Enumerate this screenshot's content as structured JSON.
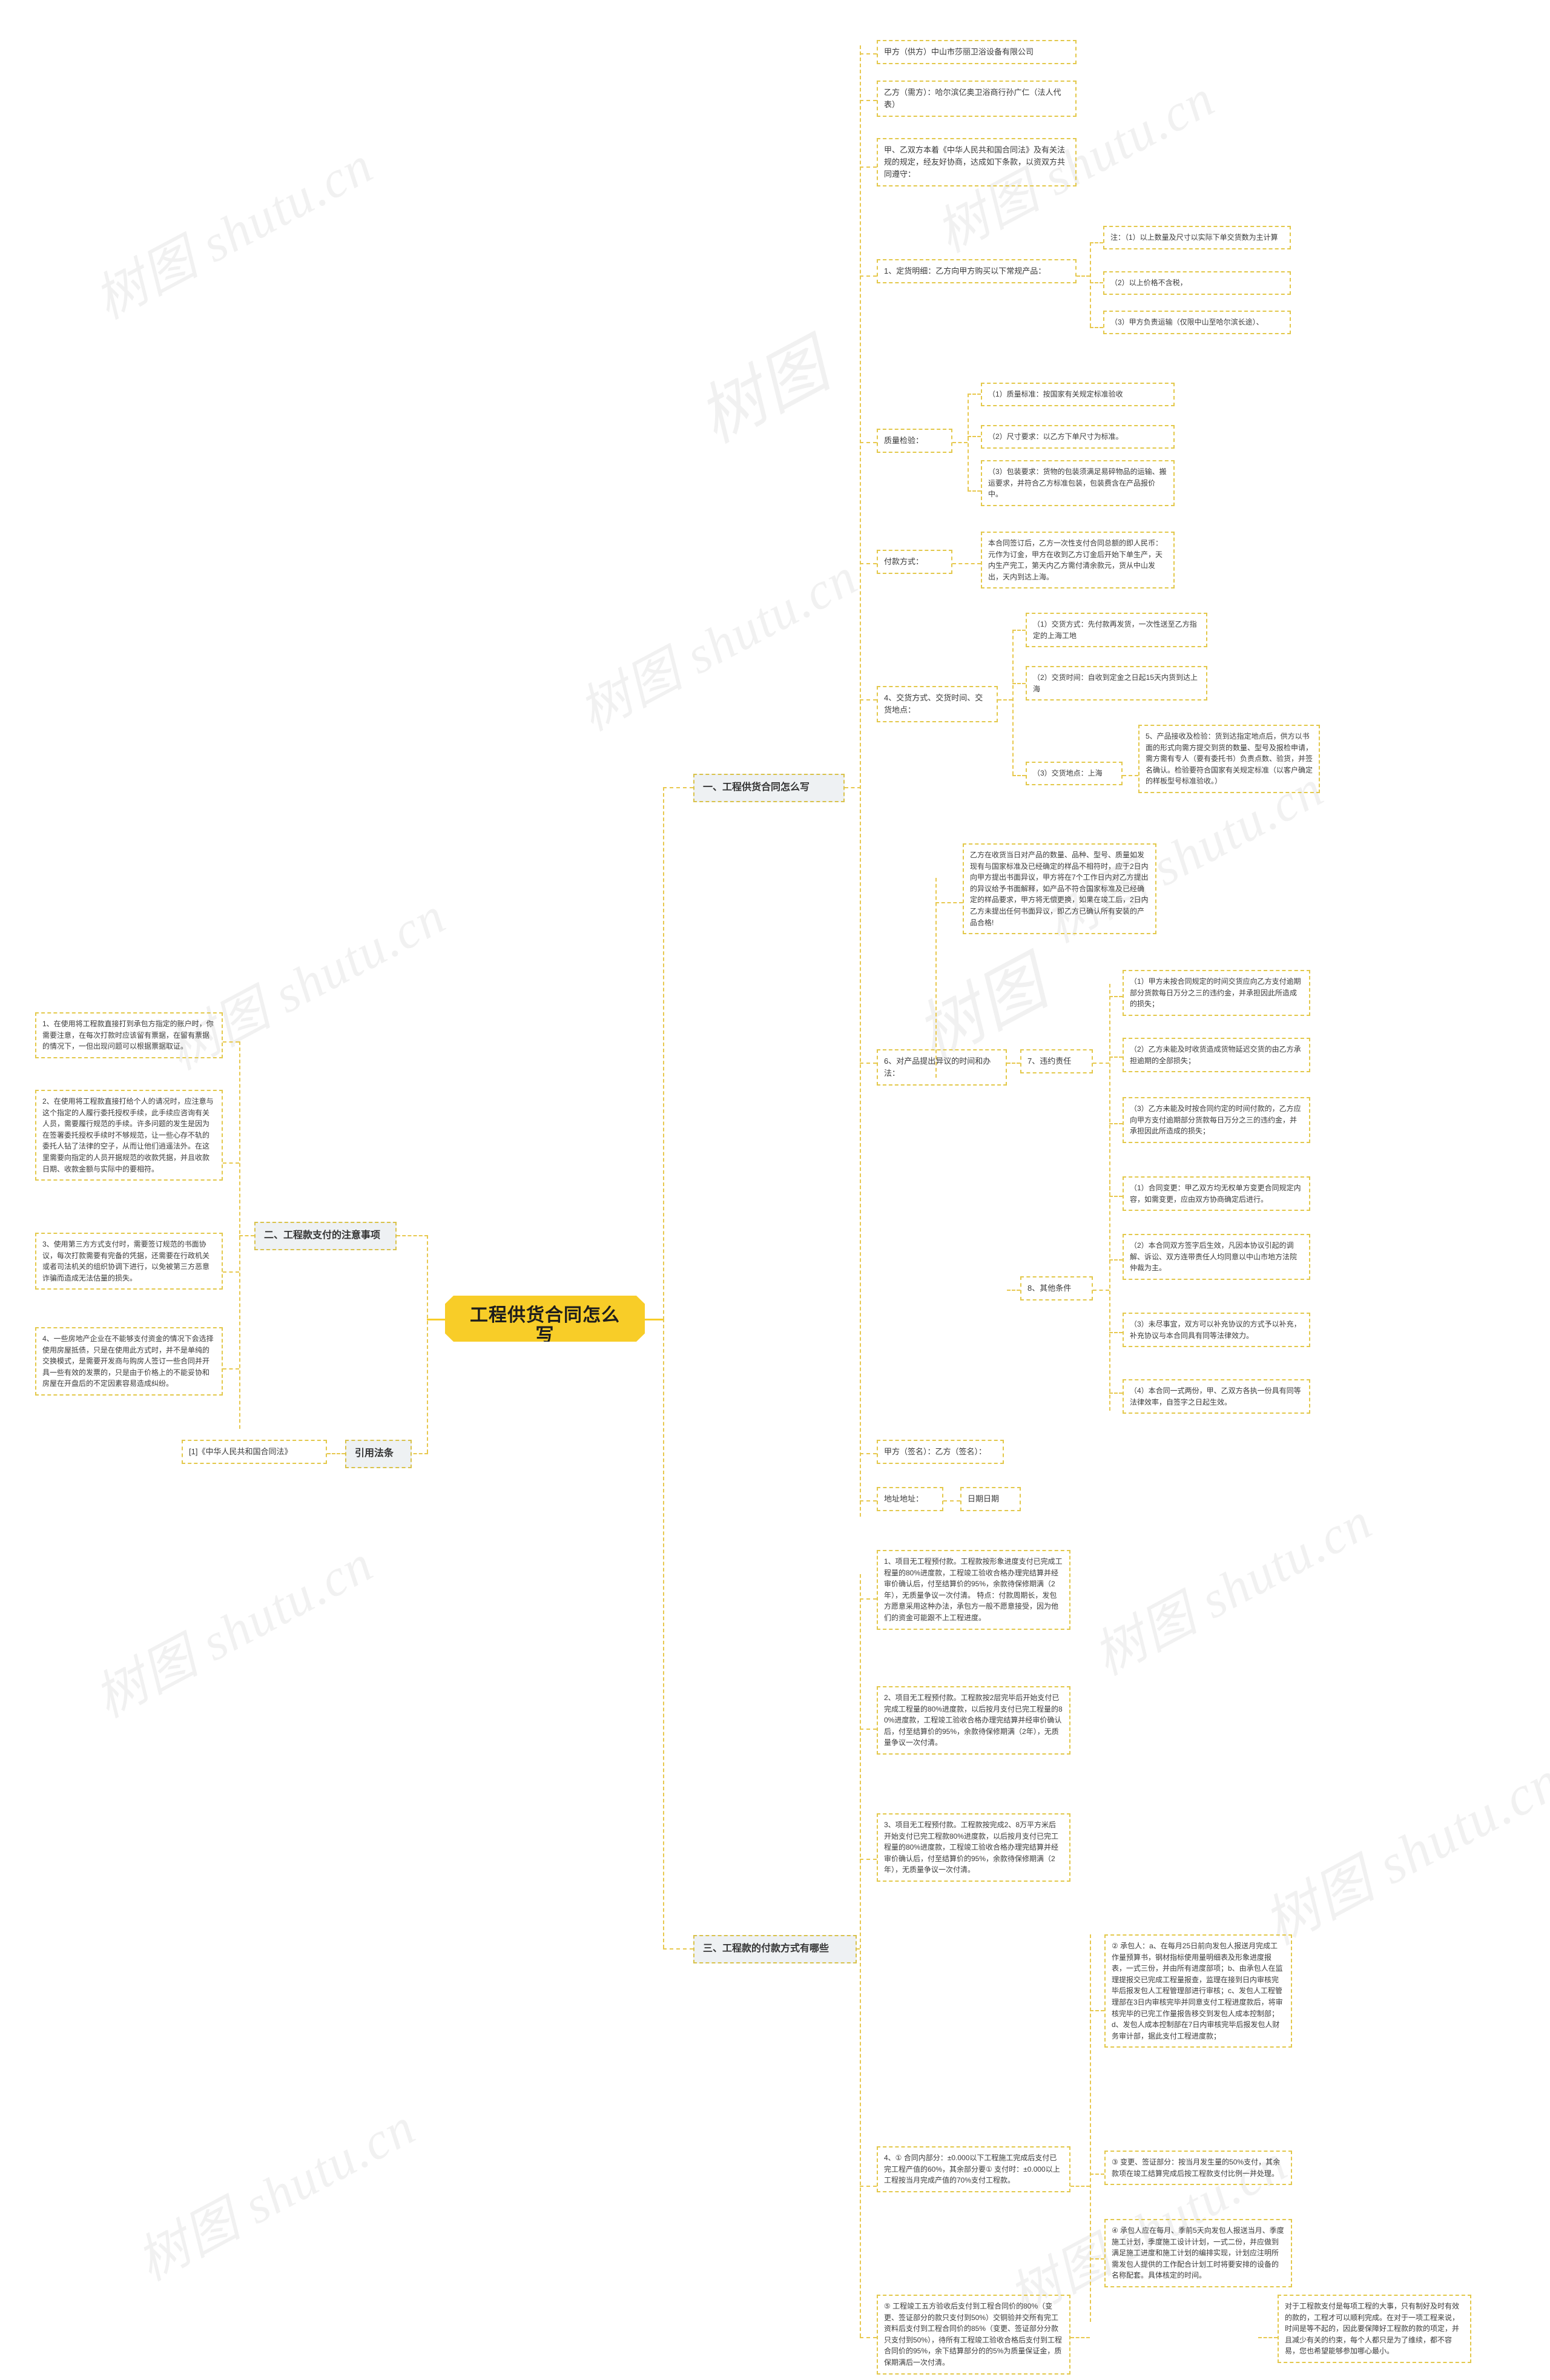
{
  "meta": {
    "root_title": "工程供货合同怎么写",
    "watermark_text_a": "树图 shutu.cn",
    "watermark_text_b": "树图",
    "accent_color": "#f8cd28",
    "branch_color": "#e3c84a",
    "node_fill": "#eef1f3"
  },
  "branches": {
    "b1": {
      "label": "一、工程供货合同怎么写"
    },
    "b2": {
      "label": "二、工程款支付的注意事项"
    },
    "b3": {
      "label": "三、工程款的付款方式有哪些"
    },
    "b4": {
      "label": "引用法条"
    }
  },
  "contract": {
    "party_a": "甲方（供方）中山市莎丽卫浴设备有限公司",
    "party_b": "乙方（需方）：哈尔滨亿奥卫浴商行孙广仁（法人代表）",
    "preamble": "甲、乙双方本着《中华人民共和国合同法》及有关法规的规定，经友好协商，达成如下条款，以资双方共同遵守：",
    "item1": {
      "label": "1、定货明细：乙方向甲方购买以下常规产品：",
      "children": [
        "注：（1）以上数量及尺寸以实际下单交货数为主计算",
        "（2）以上价格不含税，",
        "（3）甲方负责运输（仅限中山至哈尔滨长途）、"
      ]
    },
    "item2": {
      "label": "质量检验：",
      "children": [
        "（1）质量标准：按国家有关规定标准验收",
        "（2）尺寸要求：以乙方下单尺寸为标准。",
        "（3）包装要求：货物的包装须满足易碎物品的运输、搬运要求，并符合乙方标准包装，包装费含在产品报价中。"
      ]
    },
    "item3": {
      "label": "付款方式：",
      "children": [
        "本合同签订后，乙方一次性支付合同总额的即人民币：元作为订金，甲方在收到乙方订金后开始下单生产，天内生产完工，第天内乙方需付清余款元，货从中山发出，天内到达上海。"
      ]
    },
    "item4": {
      "label": "4、交货方式、交货时间、交货地点：",
      "children": [
        "（1）交货方式：先付款再发货，一次性送至乙方指定的上海工地",
        "（2）交货时间：自收到定金之日起15天内货到达上海",
        "（3）交货地点：上海"
      ]
    },
    "item5": "5、产品接收及检验：货到达指定地点后，供方以书面的形式向需方提交到货的数量、型号及报检申请，需方需有专人（要有委托书）负责点数、验货，并签名确认。检验要符合国家有关规定标准（以客户确定的样板型号标准验收。）",
    "item6": {
      "label": "6、对产品提出异议的时间和办法：",
      "note": "乙方在收货当日对产品的数量、品种、型号、质量如发现有与国家标准及已经确定的样品不相符时，应于2日内向甲方提出书面异议，甲方将在7个工作日内对乙方提出的异议给予书面解释，如产品不符合国家标准及已经确定的样品要求，甲方将无偿更换，如果在竣工后，2日内乙方未提出任何书面异议，即乙方已确认所有安装的产品合格!"
    },
    "item7": {
      "label": "7、违约责任",
      "children": [
        "（1）甲方未按合同规定的时间交货应向乙方支付逾期部分货款每日万分之三的违约金，并承担因此所造成的损失；",
        "（2）乙方未能及时收货造成货物延迟交货的由乙方承担逾期的全部损失；",
        "（3）乙方未能及时按合同约定的时间付款的，乙方应向甲方支付逾期部分货款每日万分之三的违约金，并承担因此所造成的损失；"
      ]
    },
    "item8": {
      "label": "8、其他条件",
      "children": [
        "（1）合同变更：甲乙双方均无权单方变更合同规定内容，如需变更，应由双方协商确定后进行。",
        "（2）本合同双方签字后生效，凡因本协议引起的调解、诉讼、双方连带责任人均同意以中山市地方法院仲裁为主。",
        "（3）未尽事宜，双方可以补充协议的方式予以补充，补充协议与本合同具有同等法律效力。",
        "（4）本合同一式两份，甲、乙双方各执一份具有同等法律效率，自签字之日起生效。"
      ]
    },
    "signature": "甲方（签名）：乙方（签名）：",
    "address_date": "地址地址：",
    "date": "日期日期"
  },
  "notes": {
    "n1": "1、在使用将工程款直接打到承包方指定的账户时，你需要注意，在每次打款时应该留有票据，在留有票据的情况下，一但出现问题可以根据票据取证。",
    "n2": "2、在使用将工程款直接打给个人的请况时，应注意与这个指定的人履行委托授权手续，此手续应咨询有关人员，需要履行规范的手续。许多问题的发生是因为在签署委托授权手续时不够规范，让一些心存不轨的委托人钻了法律的空子，从而让他们逍遥法外。在这里需要向指定的人员开据规范的收款凭据，并且收款日期、收款金额与实际中的要相符。",
    "n3": "3、使用第三方方式支付时，需要签订规范的书面协议，每次打款需要有完备的凭据，还需要在行政机关或者司法机关的组织协调下进行，以免被第三方恶意诈骗而造成无法估量的损失。",
    "n4": "4、一些房地产企业在不能够支付资金的情况下会选择使用房屋抵债，只是在使用此方式时，并不是单纯的交换模式，是需要开发商与购房人签订一些合同并开具一些有效的发票的，只是由于价格上的不能妥协和房屋在开盘后的不定因素容易造成纠纷。"
  },
  "law": {
    "ref": "[1]《中华人民共和国合同法》"
  },
  "payment_methods": {
    "p1": "1、项目无工程预付款。工程款按形象进度支付已完成工程量的80%进度款，工程竣工验收合格办理完结算并经审价确认后，付至结算价的95%，余款待保修期满（2年），无质量争议一次付清。 特点：付款周期长，发包方愿意采用这种办法，承包方一般不愿意接受，因为他们的资金可能跟不上工程进度。",
    "p2": "2、项目无工程预付款。工程款按2层完毕后开始支付已完成工程量的80%进度款，以后按月支付已完工程量的80%进度款，工程竣工验收合格办理完结算并经审价确认后，付至结算价的95%，余款待保修期满（2年），无质量争议一次付清。",
    "p3": "3、项目无工程预付款。工程款按完成2、8万平方米后开始支付已完工程款80%进度款，以后按月支付已完工程量的80%进度款，工程竣工验收合格办理完结算并经审价确认后，付至结算价的95%，余款待保修期满（2年），无质量争议一次付清。",
    "p4": "4、① 合同内部分：±0.000以下工程施工完成后支付已完工程产值的60%，其余部分要① 支付时：±0.000以上工程按当月完成产值的70%支付工程款。",
    "p5": "② 承包人：a、在每月25日前向发包人报送月完成工作量预算书，钢材指标使用量明细表及形象进度报表，一式三份，并由所有进度部项；b、由承包人在监理提报交已完成工程量报查，监理在接到日内审核完毕后报发包人工程管理部进行审核；c、发包人工程管理部在3日内审核完毕并同意支付工程进度款后，将审核完毕的已完工作量报告移交到发包人成本控制部；d、发包人成本控制部在7日内审核完毕后报发包人财务审计部，据此支付工程进度款；",
    "p6": "③ 变更、签证部分：按当月发生量的50%支付，其余款项在竣工结算完成后按工程款支付比例一并处理。",
    "p7": "④ 承包人应在每月、季前5天向发包人报送当月、季度施工计划，季度施工设计计划，一式二份，并应做到满足施工进度和施工计划的编排实现，计划应注明所需发包人提供的工作配合计划工时将要安排的设备的名称配套。具体核定的时间。",
    "p8": "⑤ 工程竣工五方验收后支付到工程合同价的80%（变更、签证部分的款只支付到50%）交铜验并交所有完工资料后支付到工程合同价的85%（变更、签证部分分款只支付到50%），待所有工程竣工验收合格后支付到工程合同价的95%，余下结算部分的的5%为质量保证金，质保期满后一次付清。",
    "p9": "对于工程款支付是每项工程的大事，只有制好及时有效的款的，工程才可以顺利完成。在对于一项工程来说，时间是等不起的，因此要保障好工程款的款的项定，并且减少有关的约束，每个人都只是为了维续，都不容易，您也希望能够参加哪心最小。"
  }
}
